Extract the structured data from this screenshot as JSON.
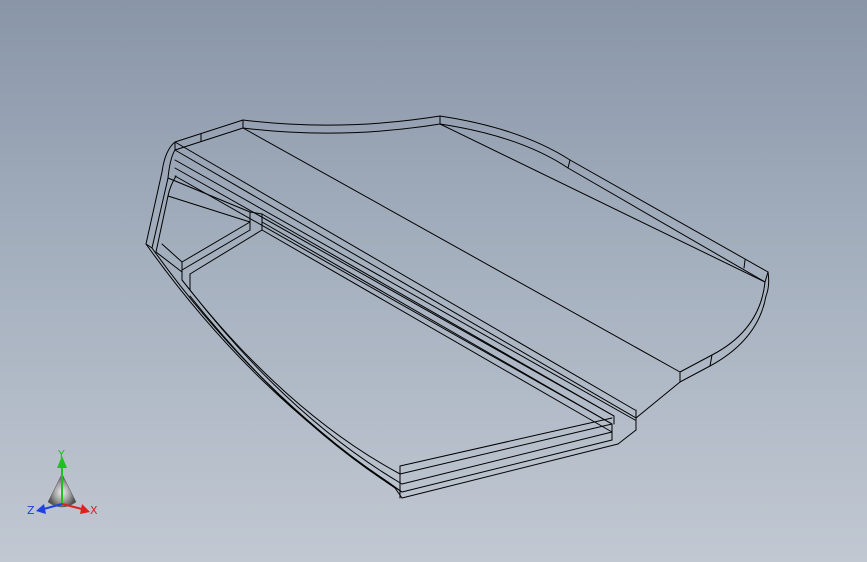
{
  "viewport": {
    "background_top": "#8996a8",
    "background_bottom": "#c1c8d2",
    "edge_color": "#000000"
  },
  "triad": {
    "x_label": "X",
    "y_label": "Y",
    "z_label": "Z",
    "x_color": "#e02020",
    "y_color": "#20c020",
    "z_color": "#2040e0"
  }
}
